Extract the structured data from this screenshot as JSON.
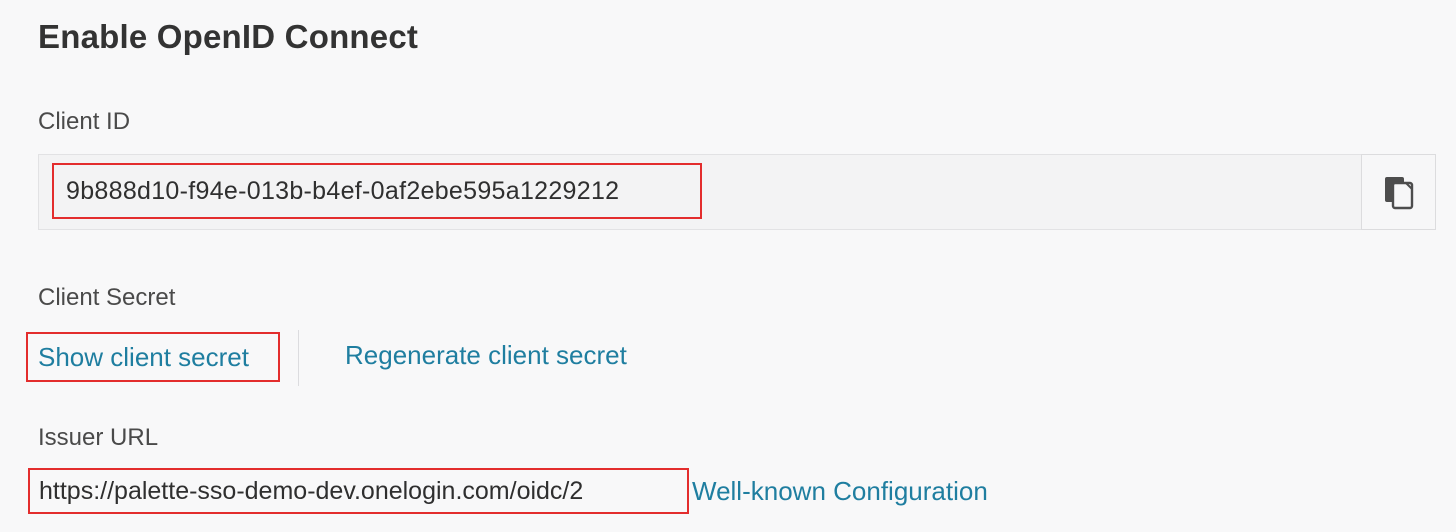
{
  "page": {
    "title": "Enable OpenID Connect"
  },
  "client_id": {
    "label": "Client ID",
    "value": "9b888d10-f94e-013b-b4ef-0af2ebe595a1229212",
    "copy_icon": "copy-icon"
  },
  "client_secret": {
    "label": "Client Secret",
    "show_label": "Show client secret",
    "regenerate_label": "Regenerate client secret"
  },
  "issuer": {
    "label": "Issuer URL",
    "url": "https://palette-sso-demo-dev.onelogin.com/oidc/2",
    "well_known_label": "Well-known Configuration"
  },
  "colors": {
    "link": "#1f7ea0",
    "highlight_border": "#e32d2d",
    "background": "#f8f8f9"
  }
}
